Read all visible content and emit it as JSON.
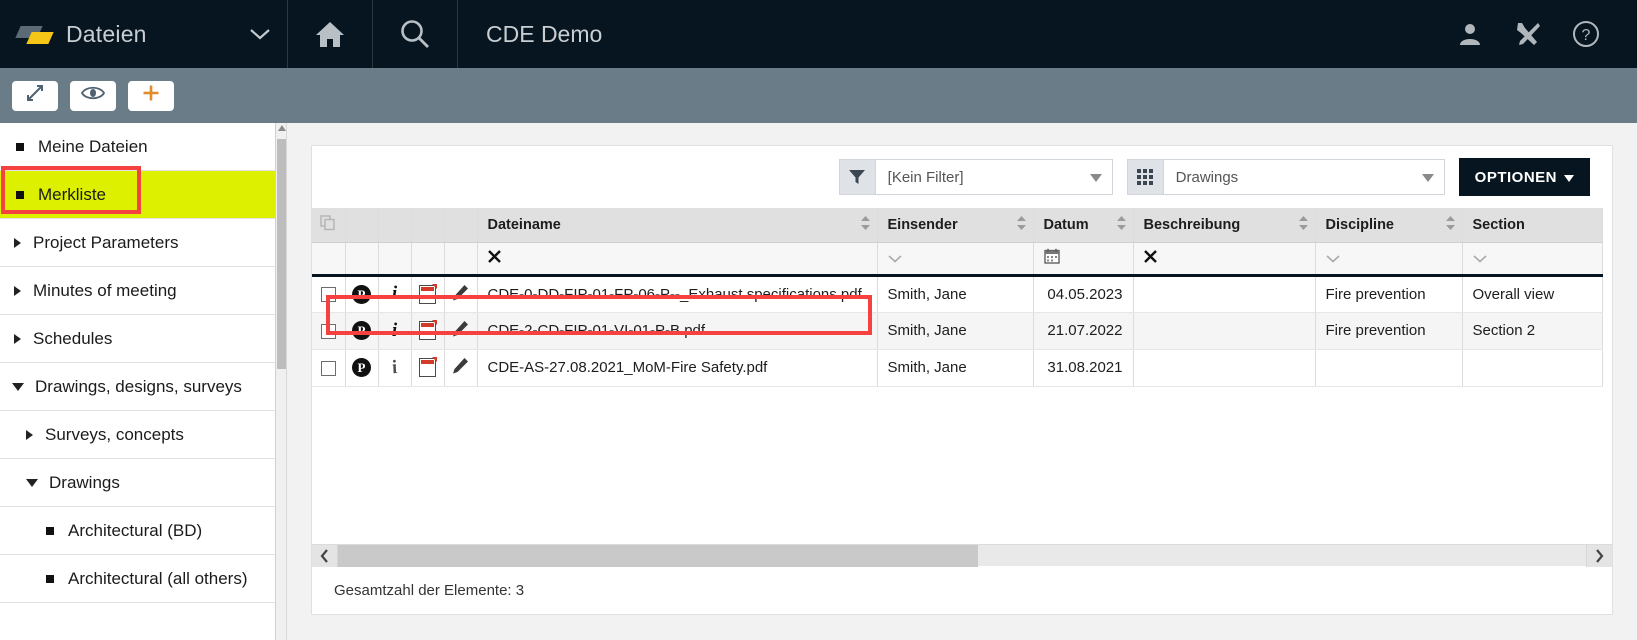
{
  "topbar": {
    "app_name": "Dateien",
    "app_caret_icon": "chevron-down-icon",
    "logo_icon": "logo-icon",
    "home_icon": "home-icon",
    "search_icon": "search-icon",
    "project_title": "CDE Demo",
    "user_icon": "user-icon",
    "tools_icon": "tools-icon",
    "help_icon": "help-circle-icon"
  },
  "subtoolbar": {
    "buttons": [
      {
        "name": "expand-button",
        "icon": "expand-arrows-icon"
      },
      {
        "name": "preview-button",
        "icon": "eye-icon"
      },
      {
        "name": "add-button",
        "icon": "plus-icon"
      }
    ]
  },
  "sidebar": {
    "items": [
      {
        "label": "Meine Dateien",
        "marker": "bullet",
        "level": 0,
        "highlighted": false
      },
      {
        "label": "Merkliste",
        "marker": "bullet",
        "level": 0,
        "highlighted": true
      },
      {
        "label": "Project Parameters",
        "marker": "arrow-right",
        "level": 0,
        "highlighted": false
      },
      {
        "label": "Minutes of meeting",
        "marker": "arrow-right",
        "level": 0,
        "highlighted": false
      },
      {
        "label": "Schedules",
        "marker": "arrow-right",
        "level": 0,
        "highlighted": false
      },
      {
        "label": "Drawings, designs, surveys",
        "marker": "arrow-down",
        "level": 0,
        "highlighted": false
      },
      {
        "label": "Surveys, concepts",
        "marker": "arrow-right",
        "level": 1,
        "highlighted": false
      },
      {
        "label": "Drawings",
        "marker": "arrow-down",
        "level": 1,
        "highlighted": false
      },
      {
        "label": "Architectural (BD)",
        "marker": "bullet",
        "level": 2,
        "highlighted": false
      },
      {
        "label": "Architectural (all others)",
        "marker": "bullet",
        "level": 2,
        "highlighted": false
      }
    ],
    "highlight_color": "#dcf000",
    "scrollbar_up_icon": "caret-up-icon"
  },
  "panel": {
    "filter": {
      "icon": "funnel-icon",
      "value": "[Kein Filter]",
      "caret_icon": "caret-down-icon"
    },
    "view": {
      "icon": "grid-icon",
      "value": "Drawings",
      "caret_icon": "caret-down-icon"
    },
    "options_button": {
      "label": "OPTIONEN",
      "caret_icon": "caret-down-icon"
    },
    "table": {
      "headers": [
        {
          "label": "",
          "name": "select-all-column",
          "icon": "copy-icon"
        },
        {
          "label": "",
          "name": "permission-column"
        },
        {
          "label": "",
          "name": "info-column"
        },
        {
          "label": "",
          "name": "filetype-column"
        },
        {
          "label": "",
          "name": "edit-column"
        },
        {
          "label": "Dateiname",
          "name": "filename-column",
          "sortable": true
        },
        {
          "label": "Einsender",
          "name": "sender-column",
          "sortable": true
        },
        {
          "label": "Datum",
          "name": "date-column",
          "sortable": true
        },
        {
          "label": "Beschreibung",
          "name": "description-column",
          "sortable": true
        },
        {
          "label": "Discipline",
          "name": "discipline-column",
          "sortable": true
        },
        {
          "label": "Section",
          "name": "section-column",
          "sortable": false
        }
      ],
      "filter_row": {
        "filename_clear_icon": "clear-x-icon",
        "sender_caret_icon": "chevron-down-icon",
        "date_calendar_icon": "calendar-icon",
        "description_clear_icon": "clear-x-icon",
        "discipline_caret_icon": "chevron-down-icon",
        "section_caret_icon": "chevron-down-icon"
      },
      "rows": [
        {
          "checkbox_icon": "checkbox-unchecked-icon",
          "permission_icon": "p-circle-icon",
          "info_icon": "info-italic-icon",
          "file_icon": "pdf-file-icon",
          "edit_icon": "pencil-icon",
          "filename": "CDE-0-DD-FIP-01-FP-06-P--_Exhaust specifications.pdf",
          "sender": "Smith, Jane",
          "date": "04.05.2023",
          "description": "",
          "discipline": "Fire prevention",
          "section": "Overall view",
          "annotated": true
        },
        {
          "checkbox_icon": "checkbox-unchecked-icon",
          "permission_icon": "p-circle-icon",
          "info_icon": "info-italic-icon",
          "file_icon": "pdf-file-icon",
          "edit_icon": "pencil-icon",
          "filename": "CDE-2-CD-FIP-01-VI-01-P-B.pdf",
          "sender": "Smith, Jane",
          "date": "21.07.2022",
          "description": "",
          "discipline": "Fire prevention",
          "section": "Section 2",
          "annotated": false
        },
        {
          "checkbox_icon": "checkbox-unchecked-icon",
          "permission_icon": "p-circle-icon",
          "info_icon": "info-italic-rotated-icon",
          "file_icon": "pdf-file-icon",
          "edit_icon": "pencil-icon",
          "filename": "CDE-AS-27.08.2021_MoM-Fire Safety.pdf",
          "sender": "Smith, Jane",
          "date": "31.08.2021",
          "description": "",
          "discipline": "",
          "section": "",
          "annotated": false
        }
      ]
    },
    "hscroll": {
      "left_arrow_icon": "chevron-left-icon",
      "right_arrow_icon": "chevron-right-icon"
    },
    "total_label": "Gesamtzahl der Elemente: 3"
  },
  "annotations": {
    "color": "#f5413f",
    "boxes": [
      "merkliste-sidebar-item",
      "first-table-row"
    ]
  }
}
